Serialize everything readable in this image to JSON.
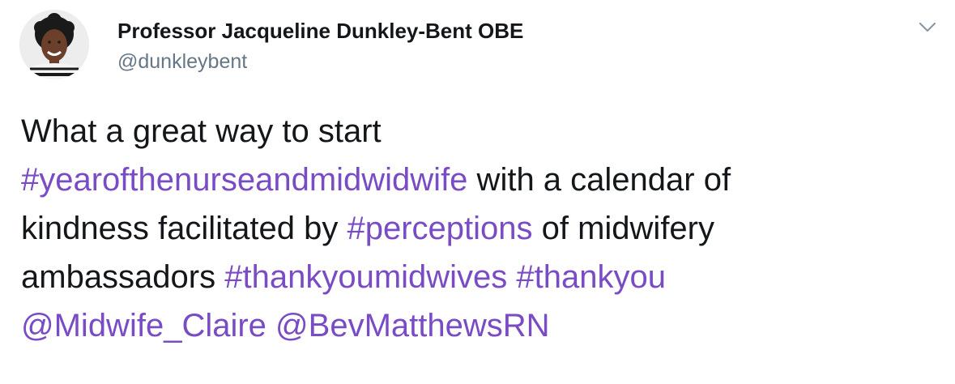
{
  "tweet": {
    "author": {
      "display_name": "Professor Jacqueline Dunkley-Bent OBE",
      "handle": "@dunkleybent",
      "avatar_icon": "profile-photo"
    },
    "menu_icon": "chevron-down-icon",
    "link_color": "#794bc4",
    "text": {
      "line1_text": "What a great way to start",
      "hashtag_1": "#yearofthenurseandmidwidwife",
      "line2_text": " with a calendar of",
      "line3_text_a": "kindness facilitated by ",
      "hashtag_2": "#perceptions",
      "line3_text_b": " of midwifery",
      "line4_text": "ambassadors ",
      "hashtag_3": "#thankyoumidwives",
      "line4_space": " ",
      "hashtag_4": "#thankyou",
      "mention_1": "@Midwife_Claire",
      "line5_space": " ",
      "mention_2": "@BevMatthewsRN"
    }
  }
}
